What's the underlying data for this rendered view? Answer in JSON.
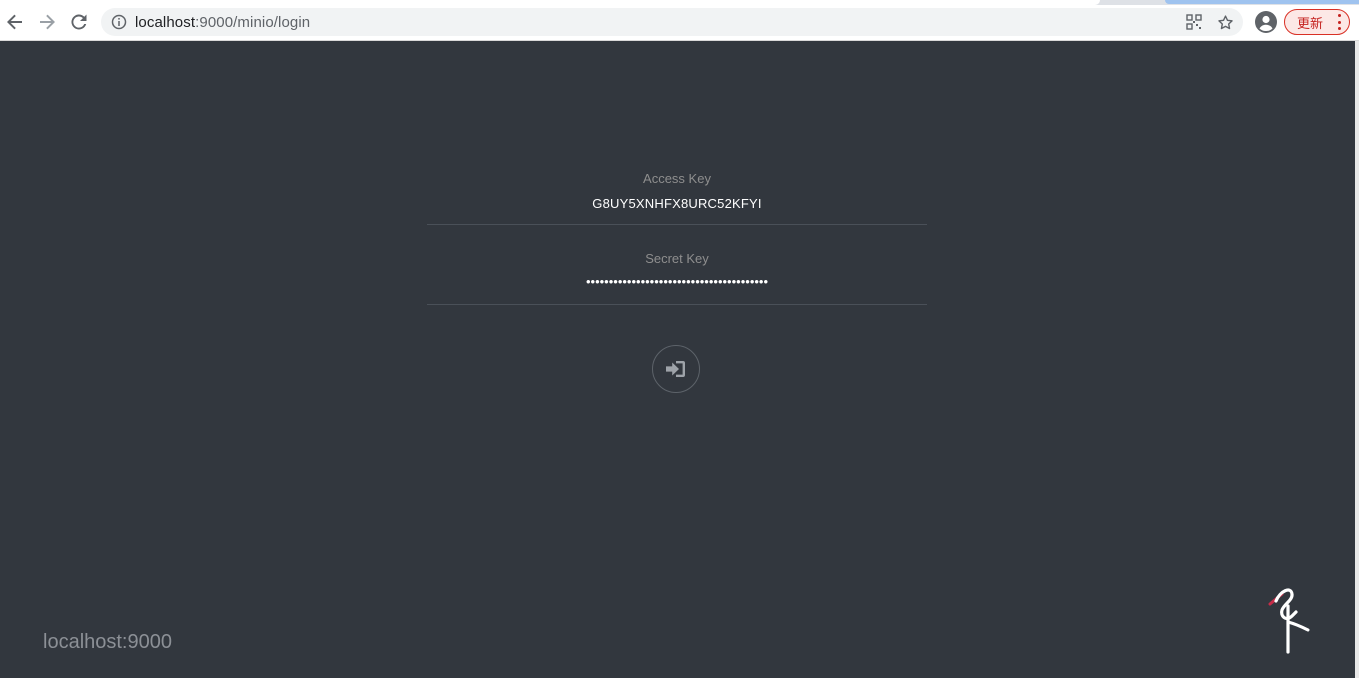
{
  "browser": {
    "url_host": "localhost",
    "url_rest": ":9000/minio/login",
    "update_label": "更新"
  },
  "login": {
    "access_key_label": "Access Key",
    "access_key_value": "G8UY5XNHFX8URC52KFYI",
    "secret_key_label": "Secret Key",
    "secret_key_value": "••••••••••••••••••••••••••••••••••••••••"
  },
  "footer": {
    "host": "localhost:9000"
  },
  "icons": {
    "back": "arrow-left-icon",
    "forward": "arrow-right-icon",
    "reload": "reload-icon",
    "info": "info-icon",
    "qr": "qr-code-icon",
    "star": "star-icon",
    "profile": "profile-icon",
    "more": "more-vertical-icon",
    "login": "sign-in-icon",
    "logo": "minio-logo-icon"
  },
  "colors": {
    "background": "#32373e",
    "accent_red": "#c5221f",
    "logo_red": "#c72c48"
  }
}
